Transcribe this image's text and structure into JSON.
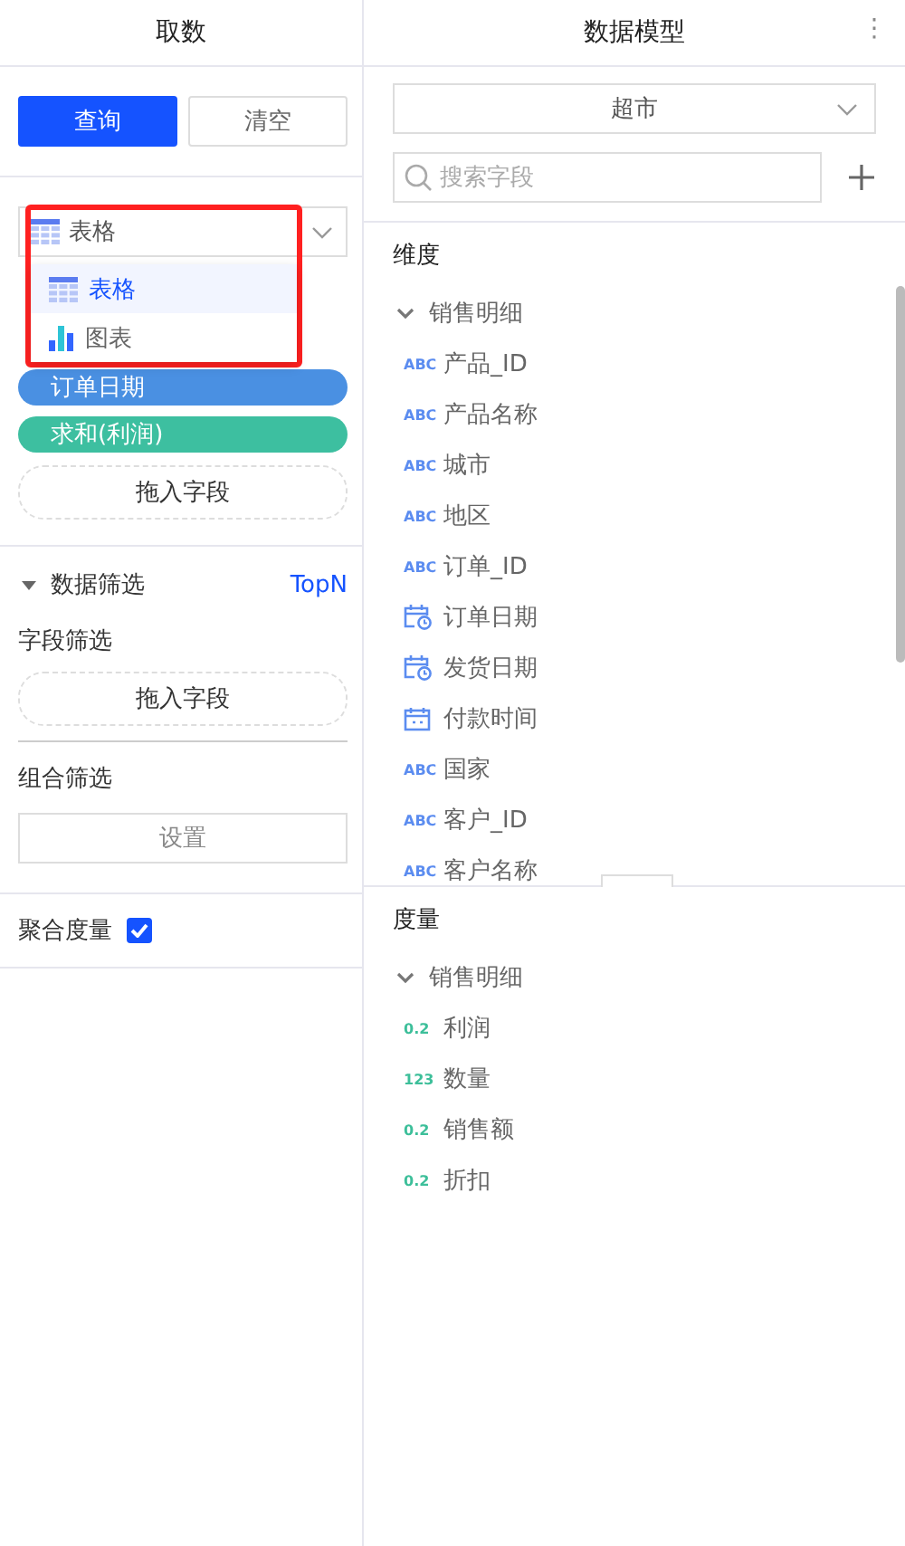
{
  "left_panel": {
    "title": "取数",
    "buttons": [
      {
        "label": "查询",
        "kind": "primary"
      },
      {
        "label": "清空",
        "kind": "default"
      }
    ],
    "chart_type_select": {
      "value": "表格",
      "kind": "table",
      "highlighted": true,
      "options": [
        {
          "label": "表格",
          "kind": "table",
          "selected": true
        },
        {
          "label": "图表",
          "kind": "chart",
          "selected": false
        }
      ]
    },
    "pills": [
      {
        "label": "订单日期",
        "color": "#4a90e2"
      },
      {
        "label": "求和(利润)",
        "color": "#3dbfa0"
      }
    ],
    "drop_zone": "拖入字段",
    "filter_section": {
      "title": "数据筛选",
      "expanded": true,
      "link": "TopN",
      "field_filter_label": "字段筛选",
      "drop_zone": "拖入字段",
      "combo_filter_label": "组合筛选",
      "setup_button": "设置"
    },
    "aggregate": {
      "label": "聚合度量",
      "checked": true
    }
  },
  "right_panel": {
    "title": "数据模型",
    "menu_icon": "⋮",
    "model_select": {
      "value": "超市"
    },
    "search": {
      "placeholder": "搜索字段"
    },
    "dimensions": {
      "title": "维度",
      "group": {
        "name": "销售明细",
        "expanded": true,
        "fields": [
          {
            "kind": "text",
            "badge": "ABC",
            "name": "产品_ID"
          },
          {
            "kind": "text",
            "badge": "ABC",
            "name": "产品名称"
          },
          {
            "kind": "text",
            "badge": "ABC",
            "name": "城市"
          },
          {
            "kind": "text",
            "badge": "ABC",
            "name": "地区"
          },
          {
            "kind": "text",
            "badge": "ABC",
            "name": "订单_ID"
          },
          {
            "kind": "datetime",
            "name": "订单日期"
          },
          {
            "kind": "datetime",
            "name": "发货日期"
          },
          {
            "kind": "date",
            "name": "付款时间"
          },
          {
            "kind": "text",
            "badge": "ABC",
            "name": "国家"
          },
          {
            "kind": "text",
            "badge": "ABC",
            "name": "客户_ID"
          },
          {
            "kind": "text",
            "badge": "ABC",
            "name": "客户名称"
          }
        ]
      }
    },
    "measures": {
      "title": "度量",
      "group": {
        "name": "销售明细",
        "expanded": true,
        "fields": [
          {
            "kind": "number",
            "badge": "0.2",
            "name": "利润"
          },
          {
            "kind": "number",
            "badge": "123",
            "name": "数量"
          },
          {
            "kind": "number",
            "badge": "0.2",
            "name": "销售额"
          },
          {
            "kind": "number",
            "badge": "0.2",
            "name": "折扣"
          }
        ]
      }
    }
  }
}
